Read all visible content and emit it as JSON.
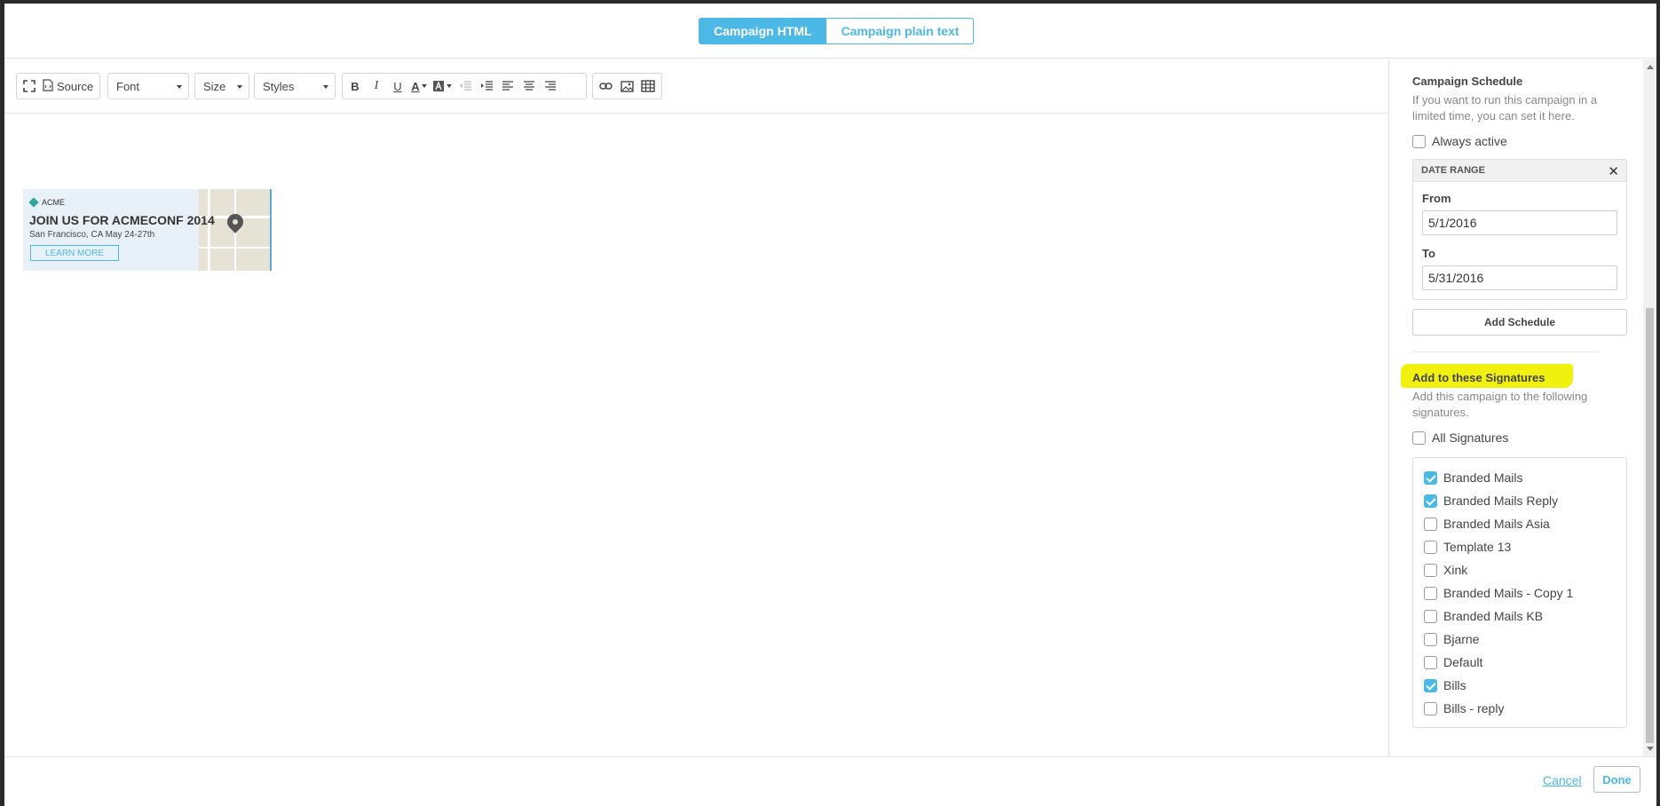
{
  "tabs": {
    "html_label": "Campaign HTML",
    "plain_label": "Campaign plain text"
  },
  "toolbar": {
    "source_label": "Source",
    "font_label": "Font",
    "size_label": "Size",
    "styles_label": "Styles",
    "bold_label": "B",
    "italic_label": "I",
    "underline_label": "U",
    "text_color_label": "A"
  },
  "banner": {
    "brand": "ACME",
    "headline": "JOIN US FOR ACMECONF 2014",
    "subline": "San Francisco, CA May 24-27th",
    "cta": "LEARN MORE"
  },
  "schedule": {
    "title": "Campaign Schedule",
    "description": "If you want to run this campaign in a limited time, you can set it here.",
    "always_active_label": "Always active",
    "always_active_checked": false,
    "date_range_title": "DATE RANGE",
    "from_label": "From",
    "from_value": "5/1/2016",
    "to_label": "To",
    "to_value": "5/31/2016",
    "add_schedule_label": "Add Schedule"
  },
  "signatures": {
    "title": "Add to these Signatures",
    "description": "Add this campaign to the following signatures.",
    "all_label": "All Signatures",
    "all_checked": false,
    "items": [
      {
        "label": "Branded Mails",
        "checked": true
      },
      {
        "label": "Branded Mails Reply",
        "checked": true
      },
      {
        "label": "Branded Mails Asia",
        "checked": false
      },
      {
        "label": "Template 13",
        "checked": false
      },
      {
        "label": "Xink",
        "checked": false
      },
      {
        "label": "Branded Mails - Copy 1",
        "checked": false
      },
      {
        "label": "Branded Mails KB",
        "checked": false
      },
      {
        "label": "Bjarne",
        "checked": false
      },
      {
        "label": "Default",
        "checked": false
      },
      {
        "label": "Bills",
        "checked": true
      },
      {
        "label": "Bills - reply",
        "checked": false
      }
    ]
  },
  "footer": {
    "cancel_label": "Cancel",
    "done_label": "Done"
  },
  "colors": {
    "accent": "#4cb8e6",
    "highlight": "#f1f10f"
  }
}
